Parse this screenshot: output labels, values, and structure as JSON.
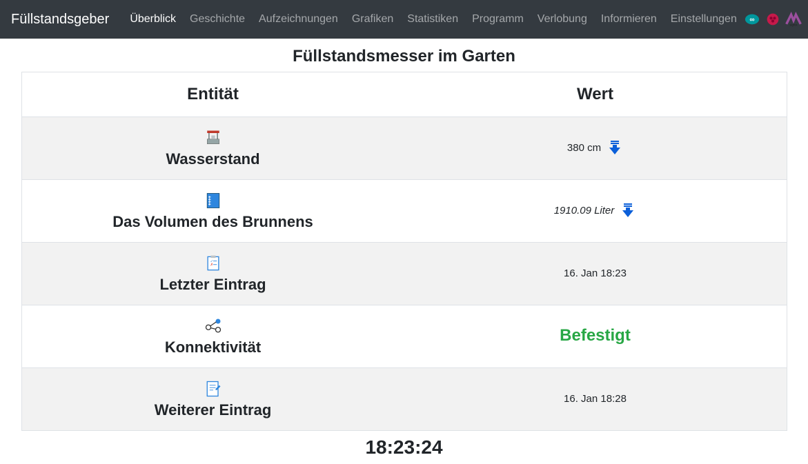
{
  "brand": "Füllstandsgeber",
  "nav": {
    "items": [
      {
        "label": "Überblick",
        "active": true
      },
      {
        "label": "Geschichte",
        "active": false
      },
      {
        "label": "Aufzeichnungen",
        "active": false
      },
      {
        "label": "Grafiken",
        "active": false
      },
      {
        "label": "Statistiken",
        "active": false
      },
      {
        "label": "Programm",
        "active": false
      },
      {
        "label": "Verlobung",
        "active": false
      },
      {
        "label": "Informieren",
        "active": false
      },
      {
        "label": "Einstellungen",
        "active": false
      }
    ]
  },
  "page_title": "Füllstandsmesser im Garten",
  "table": {
    "headers": {
      "entity": "Entität",
      "value": "Wert"
    },
    "rows": [
      {
        "entity": "Wasserstand",
        "value": "380 cm",
        "icon": "well",
        "arrow": true,
        "italic": false,
        "striped": true
      },
      {
        "entity": "Das Volumen des Brunnens",
        "value": "1910.09 Liter",
        "icon": "volume",
        "arrow": true,
        "italic": true,
        "striped": false
      },
      {
        "entity": "Letzter Eintrag",
        "value": "16. Jan 18:23",
        "icon": "clipboard",
        "arrow": false,
        "italic": false,
        "striped": true
      },
      {
        "entity": "Konnektivität",
        "value": "Befestigt",
        "icon": "network",
        "arrow": false,
        "italic": false,
        "striped": false,
        "status": "ok"
      },
      {
        "entity": "Weiterer Eintrag",
        "value": "16. Jan 18:28",
        "icon": "note",
        "arrow": false,
        "italic": false,
        "striped": true
      }
    ]
  },
  "clock": "18:23:24"
}
